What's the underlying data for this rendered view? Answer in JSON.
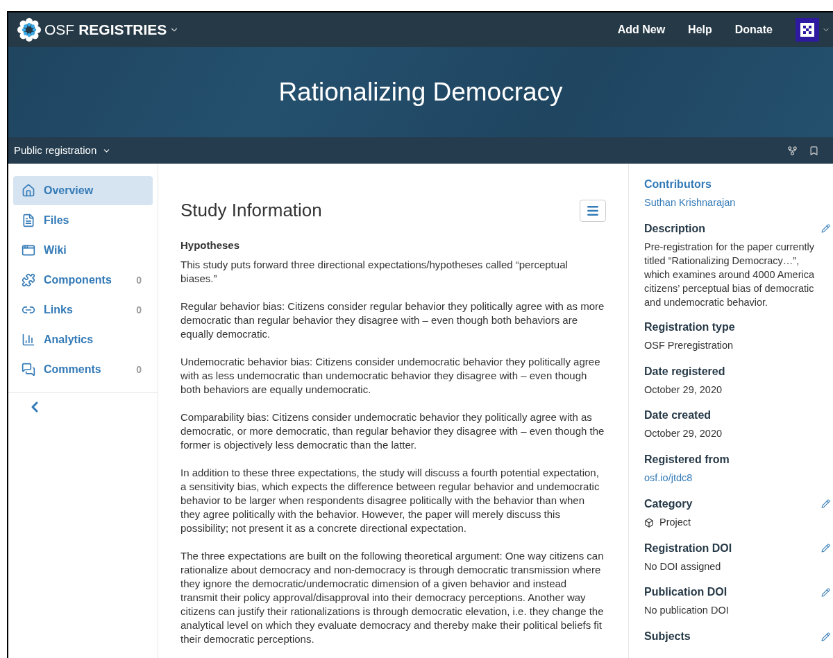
{
  "navbar": {
    "brand_light": "OSF",
    "brand_bold": "REGISTRIES",
    "links": [
      "Add New",
      "Help",
      "Donate"
    ]
  },
  "banner": {
    "title": "Rationalizing Democracy"
  },
  "subbar": {
    "label": "Public registration"
  },
  "sidebar": {
    "items": [
      {
        "label": "Overview",
        "selected": true
      },
      {
        "label": "Files",
        "selected": false
      },
      {
        "label": "Wiki",
        "selected": false
      },
      {
        "label": "Components",
        "count": "0",
        "selected": false
      },
      {
        "label": "Links",
        "count": "0",
        "selected": false
      },
      {
        "label": "Analytics",
        "selected": false
      },
      {
        "label": "Comments",
        "count": "0",
        "selected": false
      }
    ]
  },
  "main": {
    "title": "Study Information",
    "section": "Hypotheses",
    "paragraphs": [
      "This study puts forward three directional expectations/hypotheses called “perceptual biases.”",
      "Regular behavior bias: Citizens consider regular behavior they politically agree with as more democratic than regular behavior they disagree with – even though both behaviors are equally democratic.",
      "Undemocratic behavior bias: Citizens consider undemocratic behavior they politically agree with as less undemocratic than undemocratic behavior they disagree with – even though both behaviors are equally undemocratic.",
      "Comparability bias: Citizens consider undemocratic behavior they politically agree with as democratic, or more democratic, than regular behavior they disagree with – even though the former is objectively less democratic than the latter.",
      "In addition to these three expectations, the study will discuss a fourth potential expectation, a sensitivity bias, which expects the difference between regular behavior and undemocratic behavior to be larger when respondents disagree politically with the behavior than when they agree politically with the behavior. However, the paper will merely discuss this possibility; not present it as a concrete directional expectation.",
      "The three expectations are built on the following theoretical argument: One way citizens can rationalize about democracy and non-democracy is through democratic transmission where they ignore the democratic/undemocratic dimension of a given behavior and instead transmit their policy approval/disapproval into their democracy perceptions. Another way citizens can justify their rationalizations is through democratic elevation, i.e. they change the analytical level on which they evaluate democracy and thereby make their political beliefs fit their democratic perceptions."
    ]
  },
  "details": [
    {
      "kind": "link",
      "label": "Contributors",
      "value": "Suthan Krishnarajan",
      "editable": false
    },
    {
      "kind": "lines",
      "label": "Description",
      "lines": [
        "Pre-registration for the paper currently",
        "titled “Rationalizing Democracy…”,",
        "which examines around 4000 America",
        "citizens’ perceptual bias of democratic",
        "and undemocratic behavior."
      ],
      "editable": true
    },
    {
      "kind": "text",
      "label": "Registration type",
      "value": "OSF Preregistration",
      "editable": false
    },
    {
      "kind": "text",
      "label": "Date registered",
      "value": "October 29, 2020",
      "editable": false
    },
    {
      "kind": "text",
      "label": "Date created",
      "value": "October 29, 2020",
      "editable": false
    },
    {
      "kind": "link",
      "label": "Registered from",
      "value": "osf.io/jtdc8",
      "editable": false
    },
    {
      "kind": "category",
      "label": "Category",
      "value": "Project",
      "editable": true
    },
    {
      "kind": "text",
      "label": "Registration DOI",
      "value": "No DOI assigned",
      "editable": true
    },
    {
      "kind": "text",
      "label": "Publication DOI",
      "value": "No publication DOI",
      "editable": true
    },
    {
      "kind": "heading",
      "label": "Subjects",
      "editable": true
    }
  ]
}
